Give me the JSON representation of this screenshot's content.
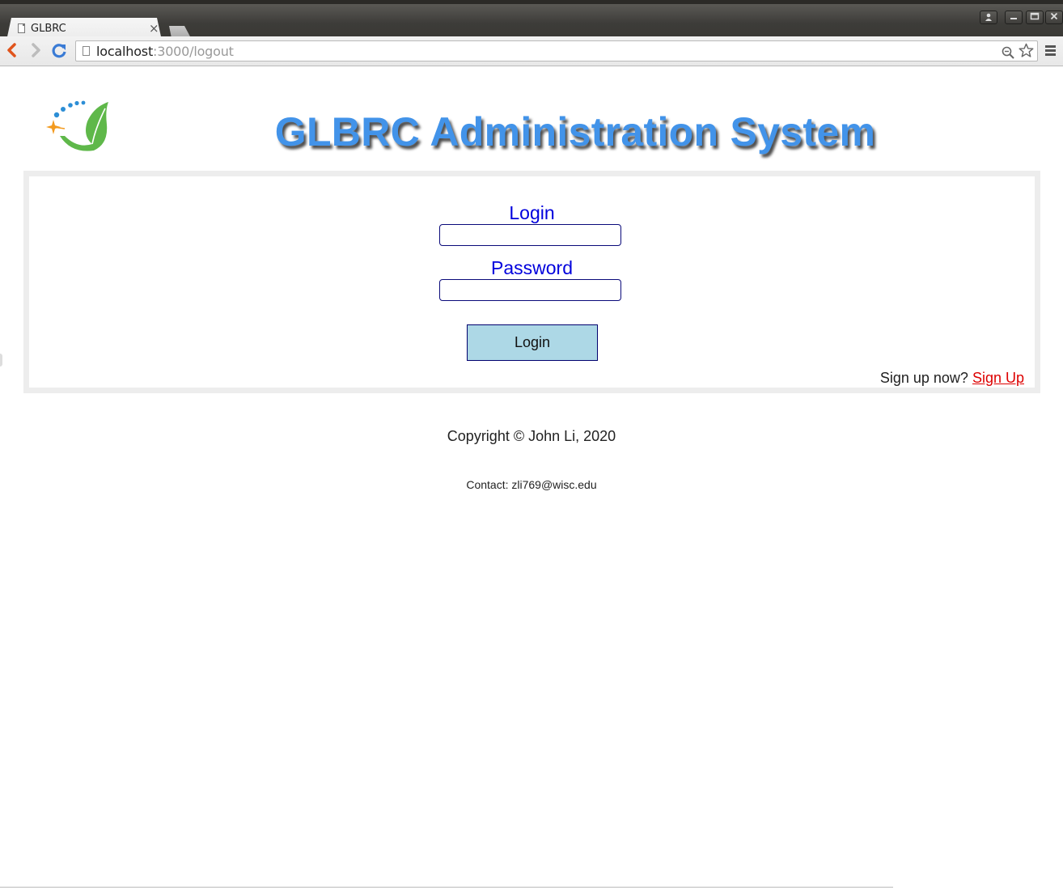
{
  "browser": {
    "tab_title": "GLBRC",
    "tab_close": "×",
    "url_host": "localhost",
    "url_path": ":3000/logout",
    "window_buttons": [
      "profile",
      "minimize",
      "maximize",
      "close"
    ]
  },
  "header": {
    "title": "GLBRC Administration System"
  },
  "login_form": {
    "login_label": "Login",
    "login_value": "",
    "password_label": "Password",
    "password_value": "",
    "submit_label": "Login",
    "signup_prompt": "Sign up now?",
    "signup_link": "Sign Up"
  },
  "footer": {
    "copyright": "Copyright © John Li, 2020",
    "contact": "Contact: zli769@wisc.edu"
  },
  "colors": {
    "title": "#4293e9",
    "label": "#0000dd",
    "button_bg": "#add8e6",
    "signup_link": "#dd0000",
    "panel_border": "#ededed"
  },
  "icons": [
    "back-arrow-icon",
    "forward-arrow-icon",
    "reload-icon",
    "page-icon",
    "zoom-icon",
    "bookmark-star-icon",
    "menu-icon",
    "leaf-logo-icon"
  ]
}
